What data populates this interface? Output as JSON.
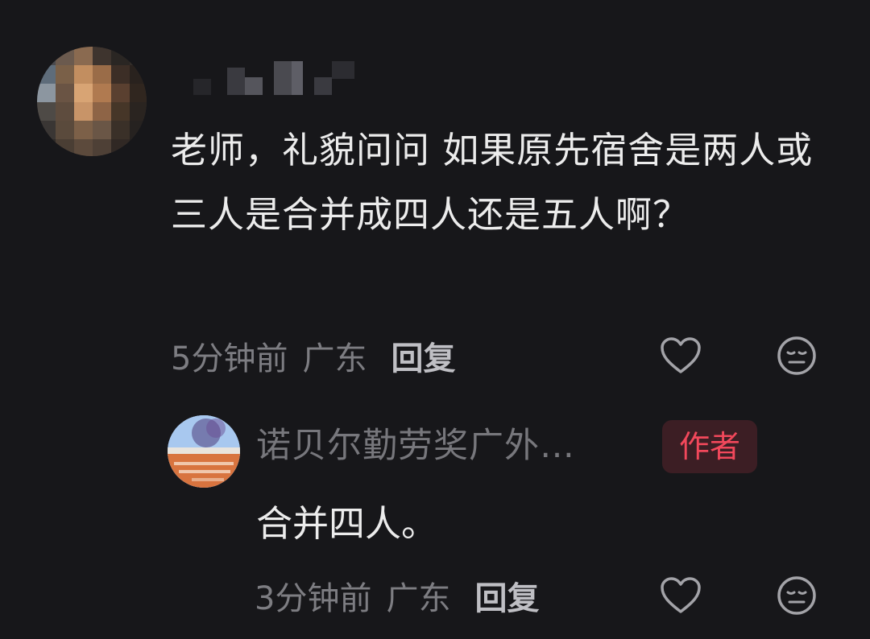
{
  "comment": {
    "text": "老师，礼貌问问 如果原先宿舍是两人或三人是合并成四人还是五人啊？",
    "time": "5分钟前",
    "location": "广东",
    "reply_label": "回复",
    "like_icon": "heart-icon",
    "dislike_icon": "meh-face-icon"
  },
  "reply": {
    "username": "诺贝尔勤劳奖广外…",
    "badge": "作者",
    "text": "合并四人。",
    "time": "3分钟前",
    "location": "广东",
    "reply_label": "回复",
    "like_icon": "heart-icon",
    "dislike_icon": "meh-face-icon"
  },
  "colors": {
    "background": "#17171a",
    "text_primary": "#ececec",
    "text_secondary": "#7d7d82",
    "author_badge_text": "#f2485b",
    "author_badge_bg": "#3c1e24"
  }
}
